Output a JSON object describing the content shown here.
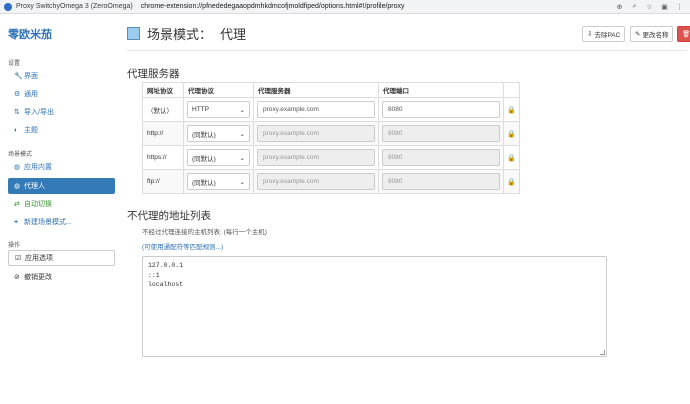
{
  "browser": {
    "tab_title": "Proxy SwitchyOmega 3 (ZeroOmega)",
    "url": "chrome-extension://pfnededegaaopdmhkdmcofjmoldfiped/options.html#!/profile/proxy"
  },
  "sidebar": {
    "brand": "零欧米茄",
    "settings_header": "设置",
    "settings_items": [
      {
        "icon": "wrench-icon",
        "glyph": "🔧",
        "label": "界面"
      },
      {
        "icon": "gear-icon",
        "glyph": "⚙",
        "label": "通用"
      },
      {
        "icon": "import-export-icon",
        "glyph": "⇅",
        "label": "导入/导出"
      },
      {
        "icon": "theme-icon",
        "glyph": "◐",
        "label": "主题"
      }
    ],
    "profiles_header": "场景模式",
    "profile_items": [
      {
        "icon": "globe-icon",
        "glyph": "◍",
        "label": "应用内置"
      },
      {
        "icon": "globe-icon",
        "glyph": "◍",
        "label": "代理人"
      },
      {
        "icon": "switch-icon",
        "glyph": "⇄",
        "label": "自动切换"
      },
      {
        "icon": "plus-icon",
        "glyph": "+",
        "label": "新建场景模式..."
      }
    ],
    "actions_header": "操作",
    "action_items": [
      {
        "icon": "check-icon",
        "glyph": "☑",
        "label": "应用选项"
      },
      {
        "icon": "undo-icon",
        "glyph": "⊘",
        "label": "撤销更改"
      }
    ]
  },
  "header": {
    "prefix": "场景模式：",
    "profile_name": "代理",
    "swatch_color": "#99ccee",
    "buttons": {
      "remove_pac": "去除PAC",
      "rename": "更改名称"
    }
  },
  "proxy_section": {
    "title": "代理服务器",
    "columns": [
      "网址协议",
      "代理协议",
      "代理服务器",
      "代理端口"
    ],
    "rows": [
      {
        "scheme": "（默认）",
        "protocol": "HTTP",
        "server_value": "proxy.example.com",
        "port_value": "8080",
        "disabled": false
      },
      {
        "scheme": "http://",
        "protocol": "(同默认)",
        "server_placeholder": "proxy.example.com",
        "port_placeholder": "8080",
        "disabled": true
      },
      {
        "scheme": "https://",
        "protocol": "(同默认)",
        "server_placeholder": "proxy.example.com",
        "port_placeholder": "8080",
        "disabled": true
      },
      {
        "scheme": "ftp://",
        "protocol": "(同默认)",
        "server_placeholder": "proxy.example.com",
        "port_placeholder": "8080",
        "disabled": true
      }
    ]
  },
  "bypass_section": {
    "title": "不代理的地址列表",
    "help": "不经过代理连接的主机列表: (每行一个主机)",
    "wildcard_link": "(可使用通配符等匹配规则...)",
    "entries": [
      "127.0.0.1",
      "::1",
      "localhost"
    ]
  }
}
